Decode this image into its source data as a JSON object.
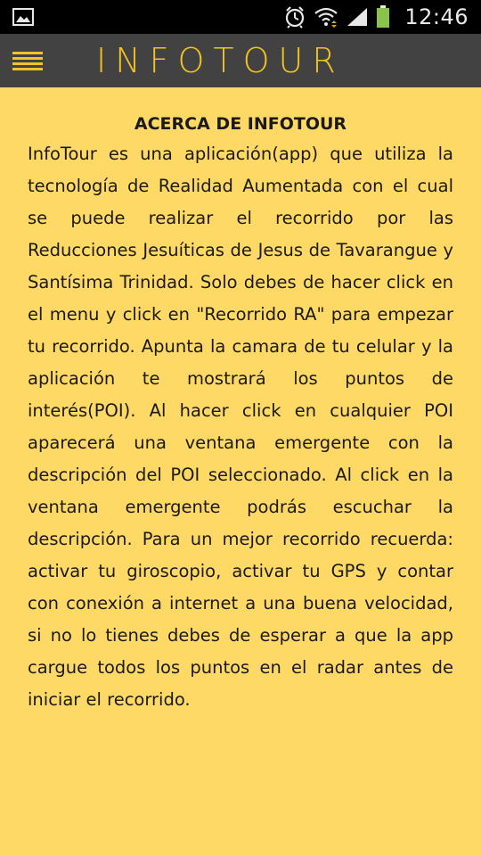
{
  "status_bar": {
    "time": "12:46",
    "icons": [
      "image-icon",
      "alarm-icon",
      "wifi-icon",
      "signal-icon",
      "battery-icon"
    ]
  },
  "app_bar": {
    "title": "INFOTOUR",
    "menu_icon": "hamburger-menu-icon",
    "background": "#424242",
    "accent": "#f3c423"
  },
  "about": {
    "heading": "ACERCA DE INFOTOUR",
    "body": "InfoTour es una aplicación(app) que utiliza la tecnología de Realidad Aumentada con el cual se puede realizar el recorrido por las Reducciones Jesuíticas de Jesus de Tavarangue y Santísima Trinidad. Solo debes de hacer click en el menu y click en \"Recorrido RA\" para empezar tu recorrido. Apunta la camara de tu celular y la aplicación te mostrará los puntos de interés(POI). Al hacer click en cualquier POI aparecerá una ventana emergente con la descripción del POI seleccionado. Al click en la ventana emergente podrás escuchar la descripción. Para un mejor recorrido recuerda: activar tu giroscopio, activar tu GPS y contar con conexión a internet a una buena velocidad, si no lo tienes debes de esperar a que la app cargue todos los puntos en el radar antes de iniciar el recorrido."
  },
  "colors": {
    "page_background": "#fed966",
    "status_bar": "#000000"
  }
}
